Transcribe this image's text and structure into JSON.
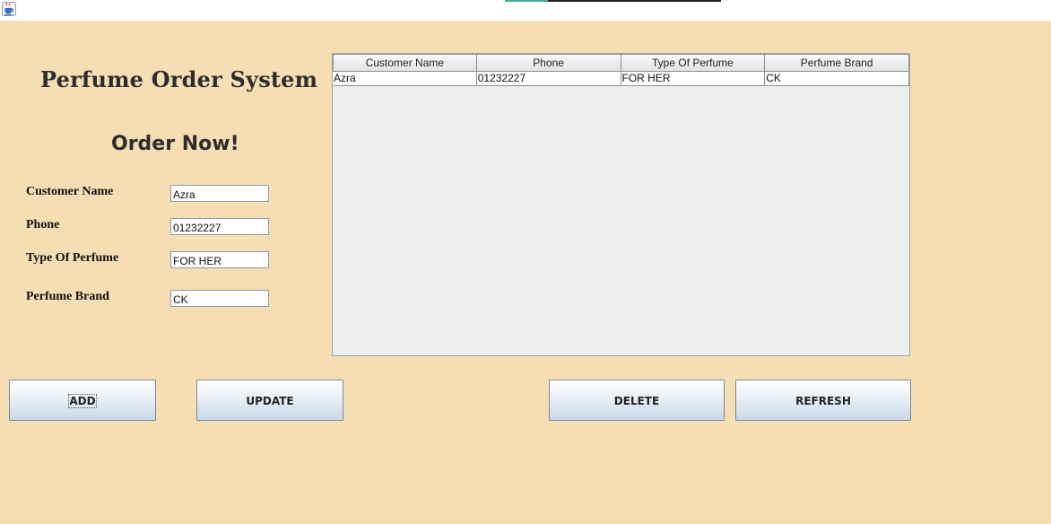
{
  "window": {
    "icon": "java-coffee-icon"
  },
  "header": {
    "title": "Perfume Order System",
    "subtitle": "Order Now!"
  },
  "form": {
    "customer_name": {
      "label": "Customer Name",
      "value": "Azra"
    },
    "phone": {
      "label": "Phone",
      "value": "01232227"
    },
    "type": {
      "label": "Type Of Perfume",
      "value": "FOR HER"
    },
    "brand": {
      "label": "Perfume Brand",
      "value": "CK"
    }
  },
  "table": {
    "columns": [
      "Customer Name",
      "Phone",
      "Type Of Perfume",
      "Perfume Brand"
    ],
    "rows": [
      [
        "Azra",
        "01232227",
        "FOR HER",
        "CK"
      ]
    ]
  },
  "buttons": {
    "add": "ADD",
    "update": "UPDATE",
    "delete": "DELETE",
    "refresh": "REFRESH"
  },
  "colors": {
    "background": "#f5deb3",
    "table_bg": "#eeeeee"
  }
}
